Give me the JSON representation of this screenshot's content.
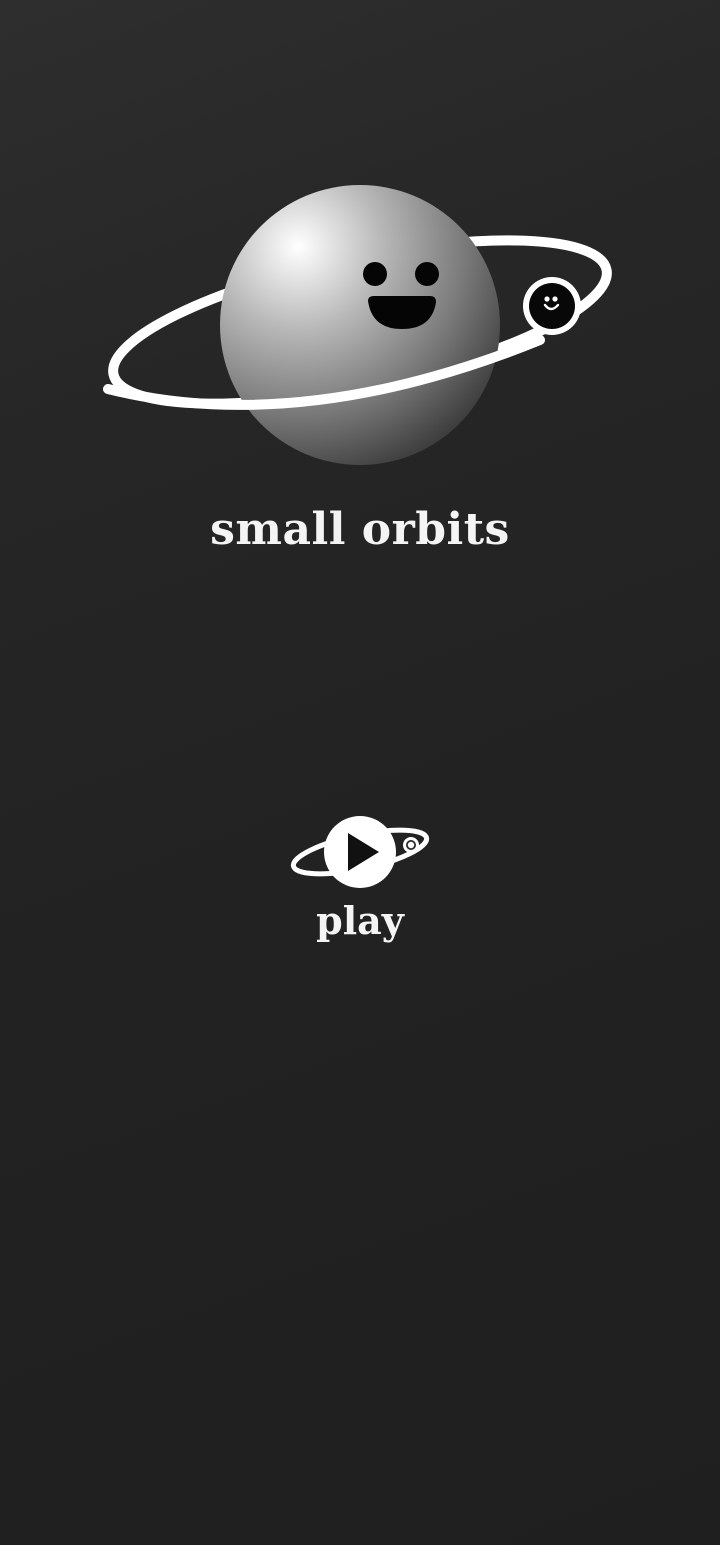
{
  "title": "small orbits",
  "play": {
    "label": "play"
  },
  "logo": {
    "icons": [
      "planet-icon",
      "orbit-ring-icon",
      "moon-icon"
    ]
  },
  "play_icon": "play-triangle-icon",
  "colors": {
    "background": "#222222",
    "text": "#f4f4f4",
    "planet_light": "#ffffff",
    "planet_dark": "#3a3a3a",
    "ring": "#ffffff",
    "moon": "#000000"
  }
}
